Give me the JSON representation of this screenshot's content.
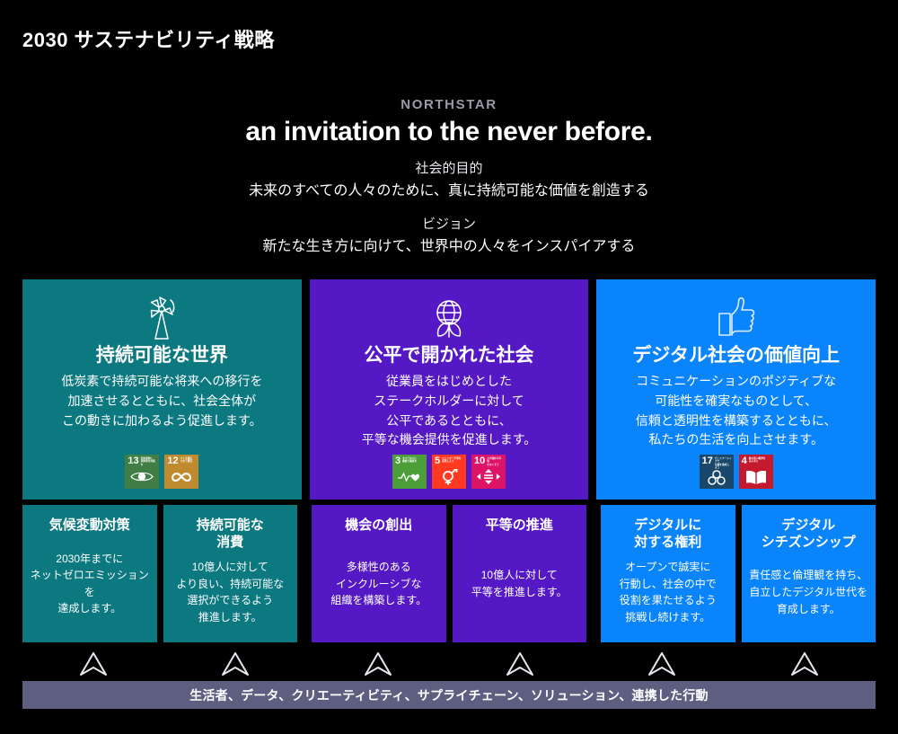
{
  "page": {
    "title": "2030 サステナビリティ戦略",
    "background_color": "#000000"
  },
  "hero": {
    "kicker": "NORTHSTAR",
    "headline": "an invitation to the never before.",
    "purpose_label": "社会的目的",
    "purpose_text": "未来のすべての人々のために、真に持続可能な価値を創造する",
    "vision_label": "ビジョン",
    "vision_text": "新たな生き方に向けて、世界中の人々をインスパイアする"
  },
  "pillars": [
    {
      "icon": "wind-turbine-icon",
      "color": "#0c7880",
      "title": "持続可能な世界",
      "description": "低炭素で持続可能な将来への移行を\n加速させるとともに、社会全体が\nこの動きに加わるよう促進します。",
      "sdgs": [
        {
          "number": "13",
          "caption": "気候変動に\n具体的な対策を",
          "color": "#3f7e44",
          "glyph": "eye-globe-icon"
        },
        {
          "number": "12",
          "caption": "つくる責任\nつかう責任",
          "color": "#bf8b2e",
          "glyph": "infinity-icon"
        }
      ]
    },
    {
      "icon": "globe-leaves-icon",
      "color": "#5419c4",
      "title": "公平で開かれた社会",
      "description": "従業員をはじめとした\nステークホルダーに対して\n公平であるとともに、\n平等な機会提供を促進します。",
      "sdgs": [
        {
          "number": "3",
          "caption": "すべての人に\n健康と福祉を",
          "color": "#4c9f38",
          "glyph": "heartbeat-icon"
        },
        {
          "number": "5",
          "caption": "ジェンダー平等を\n実現しよう",
          "color": "#ff3a21",
          "glyph": "gender-icon"
        },
        {
          "number": "10",
          "caption": "人や国の不平等\nをなくそう",
          "color": "#dd1367",
          "glyph": "equal-arrows-icon"
        }
      ]
    },
    {
      "icon": "thumbs-up-icon",
      "color": "#0a84fb",
      "title": "デジタル社会の価値向上",
      "description": "コミュニケーションのポジティブな\n可能性を確実なものとして、\n信頼と透明性を構築するとともに、\n私たちの生活を向上させます。",
      "sdgs": [
        {
          "number": "17",
          "caption": "パートナーシップで\n目標を達成しよう",
          "color": "#19486a",
          "glyph": "rings-icon"
        },
        {
          "number": "4",
          "caption": "質の高い教育を\nみんなに",
          "color": "#c5192d",
          "glyph": "book-icon"
        }
      ]
    }
  ],
  "commitments": [
    {
      "group": "teal",
      "title": "気候変動対策",
      "description": "2030年までに\nネットゼロエミッションを\n達成します。"
    },
    {
      "group": "teal",
      "title": "持続可能な\n消費",
      "description": "10億人に対して\nより良い、持続可能な\n選択ができるよう\n推進します。"
    },
    {
      "group": "purple",
      "title": "機会の創出",
      "description": "多様性のある\nインクルーシブな\n組織を構築します。"
    },
    {
      "group": "purple",
      "title": "平等の推進",
      "description": "10億人に対して\n平等を推進します。"
    },
    {
      "group": "blue",
      "title": "デジタルに\n対する権利",
      "description": "オープンで誠実に\n行動し、社会の中で\n役割を果たせるよう\n挑戦し続けます。"
    },
    {
      "group": "blue",
      "title": "デジタル\nシチズンシップ",
      "description": "責任感と倫理観を持ち、\n自立したデジタル世代を\n育成します。"
    }
  ],
  "chevrons": {
    "count": 6,
    "icon": "chevron-up-icon"
  },
  "footer": {
    "text": "生活者、データ、クリエーティビティ、サプライチェーン、ソリューション、連携した行動",
    "bar_color": "#5e5e80"
  }
}
